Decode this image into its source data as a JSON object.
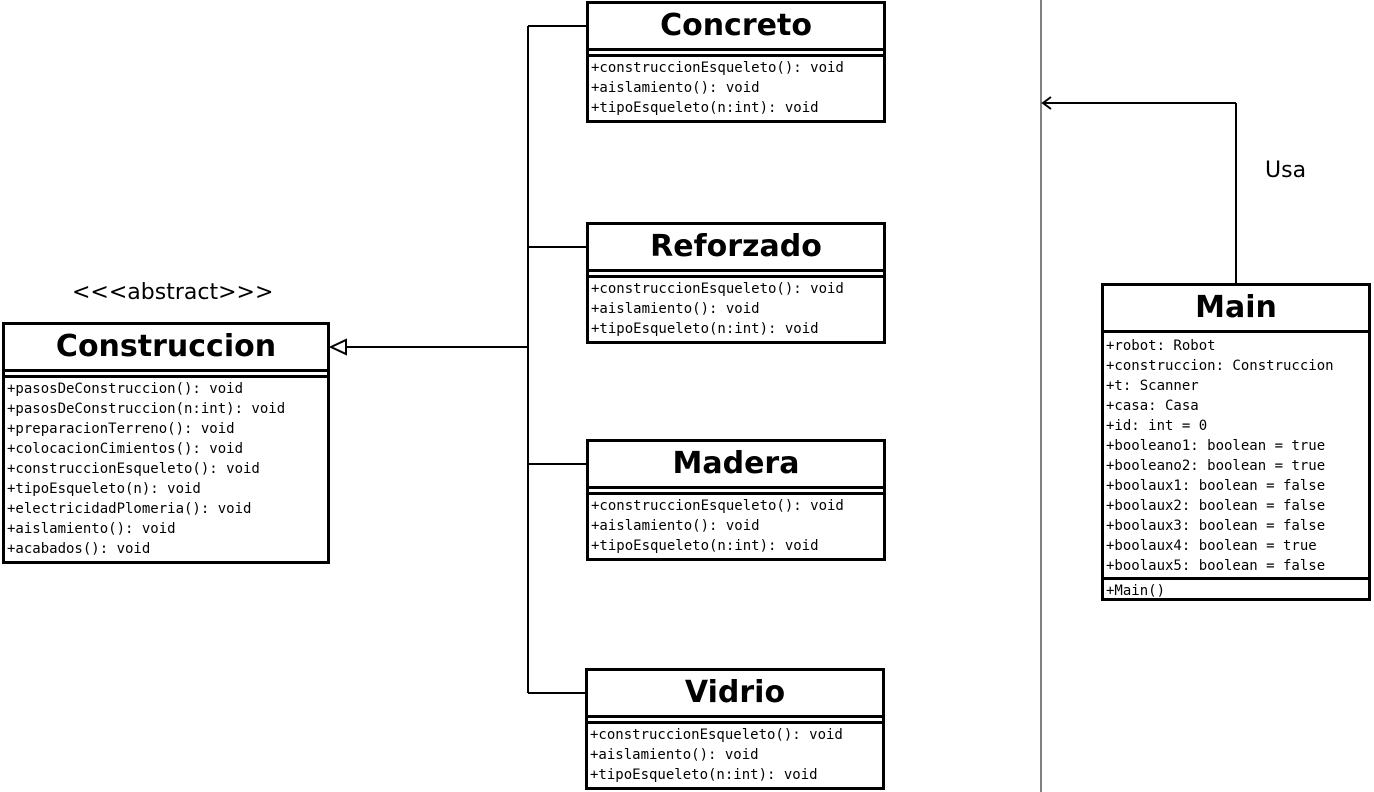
{
  "stereotype": "<<<abstract>>>",
  "classes": {
    "construccion": {
      "name": "Construccion",
      "operations": [
        "+pasosDeConstruccion(): void",
        "+pasosDeConstruccion(n:int): void",
        "+preparacionTerreno(): void",
        "+colocacionCimientos(): void",
        "+construccionEsqueleto(): void",
        "+tipoEsqueleto(n): void",
        "+electricidadPlomeria(): void",
        "+aislamiento(): void",
        "+acabados(): void"
      ]
    },
    "concreto": {
      "name": "Concreto",
      "operations": [
        "+construccionEsqueleto(): void",
        "+aislamiento(): void",
        "+tipoEsqueleto(n:int): void"
      ]
    },
    "reforzado": {
      "name": "Reforzado",
      "operations": [
        "+construccionEsqueleto(): void",
        "+aislamiento(): void",
        "+tipoEsqueleto(n:int): void"
      ]
    },
    "madera": {
      "name": "Madera",
      "operations": [
        "+construccionEsqueleto(): void",
        "+aislamiento(): void",
        "+tipoEsqueleto(n:int): void"
      ]
    },
    "vidrio": {
      "name": "Vidrio",
      "operations": [
        "+construccionEsqueleto(): void",
        "+aislamiento(): void",
        "+tipoEsqueleto(n:int): void"
      ]
    },
    "main": {
      "name": "Main",
      "attributes": [
        "+robot: Robot",
        "+construccion: Construccion",
        "+t: Scanner",
        "+casa: Casa",
        "+id: int = 0",
        "+booleano1: boolean = true",
        "+booleano2: boolean = true",
        "+boolaux1: boolean = false",
        "+boolaux2: boolean = false",
        "+boolaux3: boolean = false",
        "+boolaux4: boolean = true",
        "+boolaux5: boolean = false"
      ],
      "operations": [
        "+Main()"
      ]
    }
  },
  "relations": {
    "uses_label": "Usa"
  }
}
